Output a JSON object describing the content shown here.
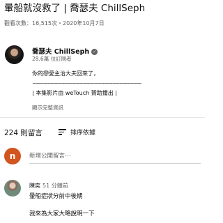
{
  "video": {
    "title": "暈船就沒救了 | 喬瑟夫 ChillSeph",
    "meta": "觀看次數：16,515次・2020年10月7日"
  },
  "channel": {
    "name": "喬瑟夫 ChillSeph",
    "subscribers": "28.6萬 位訂閱者",
    "description": [
      "你的戀愛主治大夫回來了，",
      "~~~~~~~~~~~~~~~~~~~~~~~~~~~~~~",
      "| 本集影片由 weTouch 贊助播出 |"
    ],
    "show_more": "顯示完整資訊"
  },
  "comments": {
    "count_label": "224 則留言",
    "sort_label": "排序依據",
    "avatar_letter": "n",
    "add_placeholder": "新增公開留言⋯",
    "items": [
      {
        "author": "陳奕",
        "time": "51 分鐘前",
        "lines": [
          "暈船症狀分前中後期",
          "我來為大家大略說明一下"
        ]
      }
    ]
  },
  "colors": {
    "avatar_n": "#d2541e",
    "secondary_text": "#606060",
    "primary_text": "#0f0f0f"
  }
}
